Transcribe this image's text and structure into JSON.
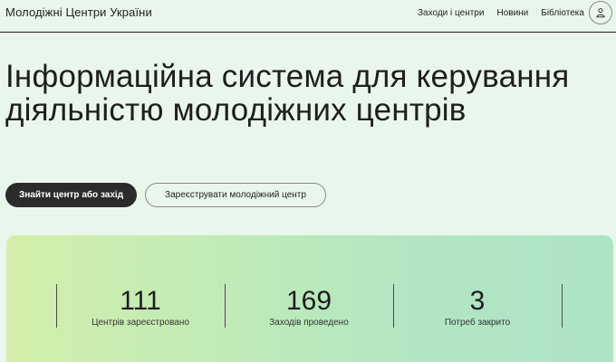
{
  "header": {
    "logo": "Молодіжні Центри України",
    "nav": [
      {
        "label": "Заходи і центри"
      },
      {
        "label": "Новини"
      },
      {
        "label": "Бібліотека"
      }
    ],
    "profile_icon": "user-icon"
  },
  "hero": {
    "title": "Інформаційна система для керування діяльністю молодіжних центрів",
    "primary_button": "Знайти центр або захід",
    "secondary_button": "Зареєструвати молодіжний центр"
  },
  "stats": [
    {
      "value": "111",
      "label": "Центрів зареєстровано"
    },
    {
      "value": "169",
      "label": "Заходів проведено"
    },
    {
      "value": "3",
      "label": "Потреб закрито"
    }
  ],
  "colors": {
    "background": "#e9f6ec",
    "primary_button": "#2b2b2b",
    "card_gradient_start": "#d3eeaa",
    "card_gradient_end": "#ace4c6"
  }
}
